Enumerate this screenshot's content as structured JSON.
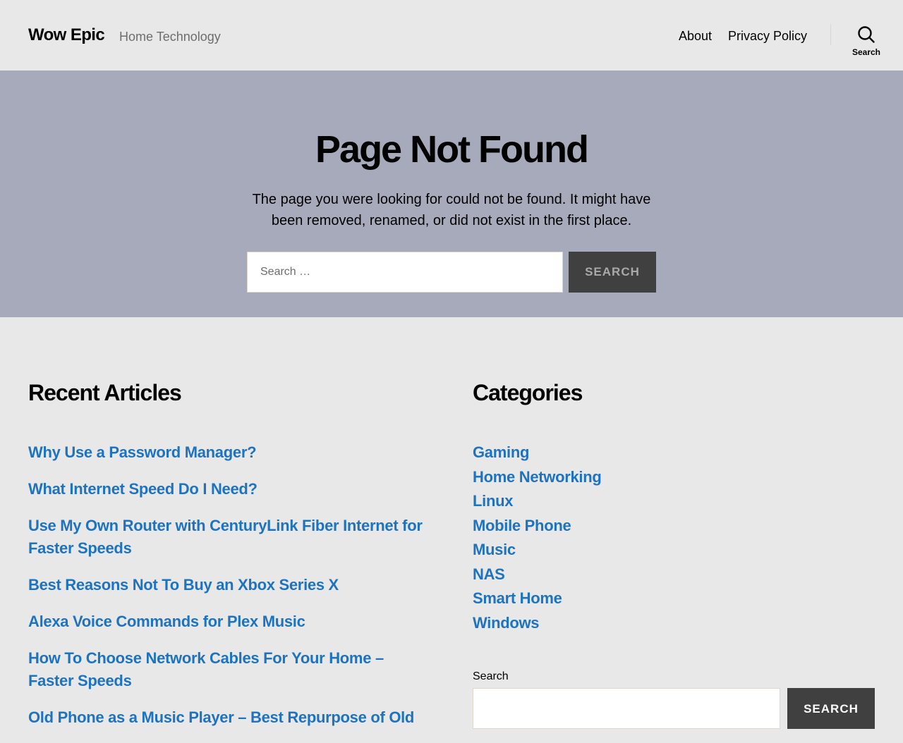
{
  "header": {
    "site_title": "Wow Epic",
    "site_description": "Home Technology",
    "nav": [
      {
        "label": "About"
      },
      {
        "label": "Privacy Policy"
      }
    ],
    "search_toggle_label": "Search",
    "search_toggle_icon": "search-icon"
  },
  "hero": {
    "title": "Page Not Found",
    "text": "The page you were looking for could not be found. It might have been removed, renamed, or did not exist in the first place.",
    "search_placeholder": "Search …",
    "search_button": "Search"
  },
  "recent": {
    "title": "Recent Articles",
    "items": [
      {
        "label": "Why Use a Password Manager?"
      },
      {
        "label": "What Internet Speed Do I Need?"
      },
      {
        "label": "Use My Own Router with CenturyLink Fiber Internet for Faster Speeds"
      },
      {
        "label": "Best Reasons Not To Buy an Xbox Series X"
      },
      {
        "label": "Alexa Voice Commands for Plex Music"
      },
      {
        "label": "How To Choose Network Cables For Your Home – Faster Speeds"
      },
      {
        "label": "Old Phone as a Music Player – Best Repurpose of Old"
      }
    ]
  },
  "categories": {
    "title": "Categories",
    "items": [
      {
        "label": "Gaming"
      },
      {
        "label": "Home Networking"
      },
      {
        "label": "Linux"
      },
      {
        "label": "Mobile Phone"
      },
      {
        "label": "Music"
      },
      {
        "label": "NAS"
      },
      {
        "label": "Smart Home"
      },
      {
        "label": "Windows"
      }
    ]
  },
  "widget_search": {
    "label": "Search",
    "button": "Search"
  },
  "colors": {
    "link": "#1e73be",
    "hero_bg": "#a6aabb",
    "page_bg": "#e8e8e9",
    "button_bg": "#404040"
  }
}
